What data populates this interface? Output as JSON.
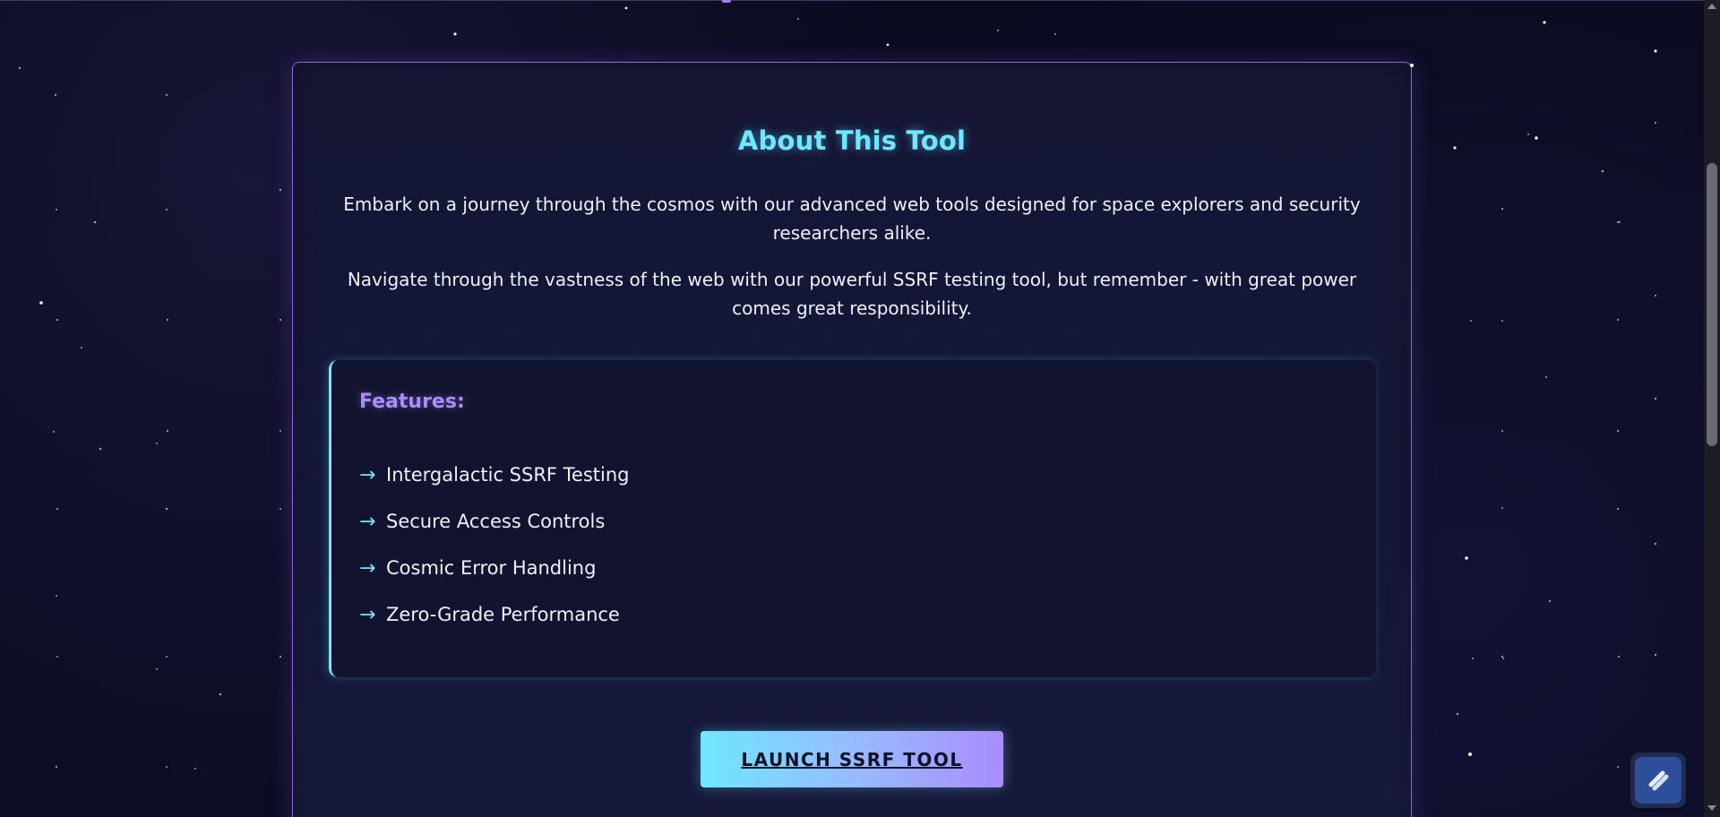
{
  "card": {
    "title": "About This Tool",
    "paragraphs": [
      "Embark on a journey through the cosmos with our advanced web tools designed for space explorers and security researchers alike.",
      "Navigate through the vastness of the web with our powerful SSRF testing tool, but remember - with great power comes great responsibility."
    ],
    "features": {
      "heading": "Features:",
      "arrow_glyph": "→",
      "items": [
        "Intergalactic SSRF Testing",
        "Secure Access Controls",
        "Cosmic Error Handling",
        "Zero-Grade Performance"
      ]
    },
    "launch_button_label": "LAUNCH SSRF TOOL"
  },
  "icons": {
    "feature_bullet": "arrow-right-icon",
    "floating_widget": "slash-badge-icon"
  },
  "colors": {
    "background": "#0b0c22",
    "card_border": "#aa7eff",
    "title_cyan": "#6fe7ff",
    "heading_purple": "#a98cff",
    "button_gradient_start": "#6fe7ff",
    "button_gradient_end": "#a98cff"
  }
}
